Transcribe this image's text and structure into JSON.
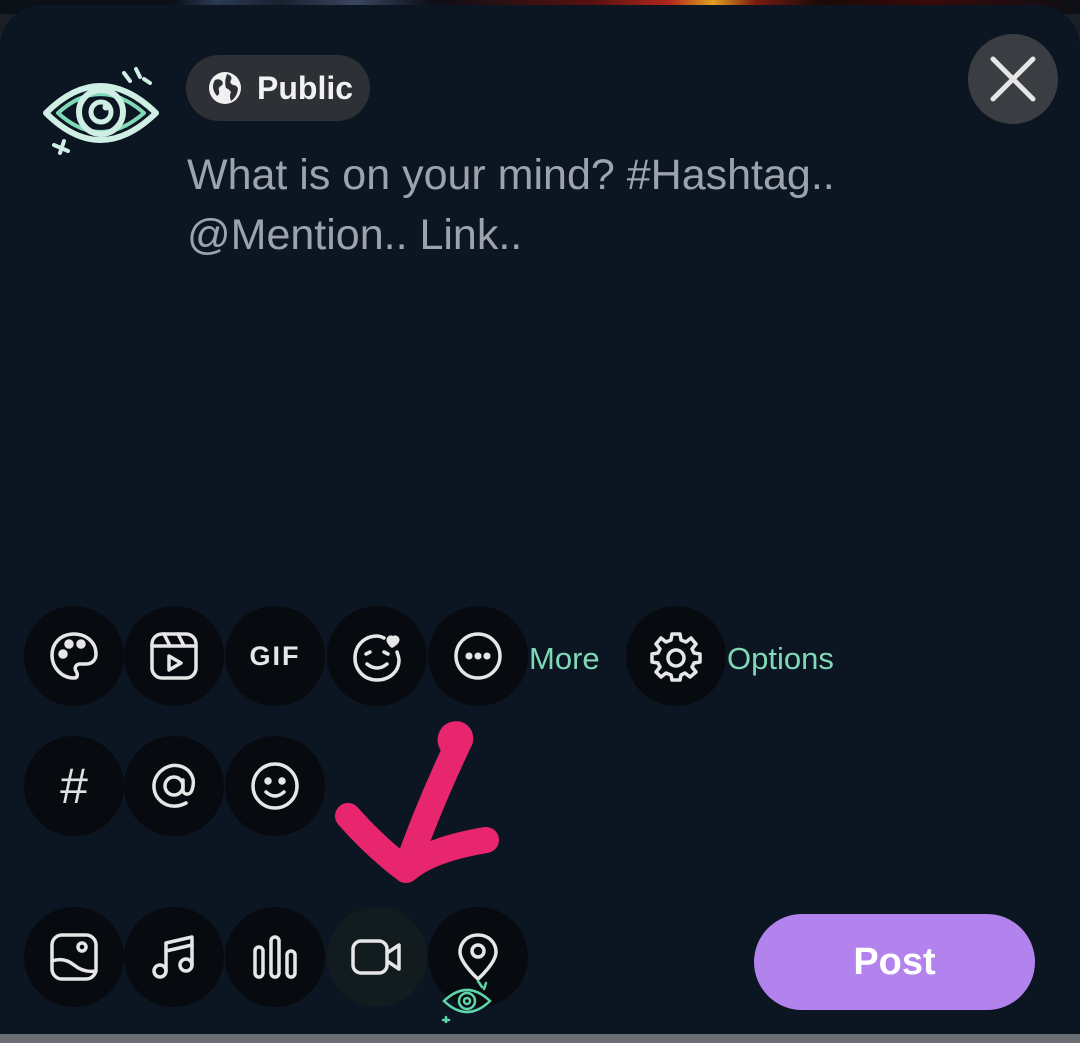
{
  "header": {
    "visibility_label": "Public",
    "visibility_icon": "globe-icon",
    "close_icon": "close-icon"
  },
  "composer": {
    "placeholder": "What is on your mind? #Hashtag.. @Mention.. Link.."
  },
  "toolbar_row1": {
    "items": [
      "palette-icon",
      "reel-icon",
      "gif-icon",
      "emoji-heart-icon",
      "more-dots-icon"
    ],
    "gif_label": "GIF",
    "more_label": "More",
    "options_label": "Options",
    "options_icon": "gear-icon"
  },
  "toolbar_row2": {
    "items": [
      "hashtag-icon",
      "mention-icon",
      "smiley-icon"
    ],
    "hash_label": "#"
  },
  "toolbar_row3": {
    "items": [
      "image-icon",
      "music-icon",
      "poll-icon",
      "video-icon",
      "location-icon"
    ]
  },
  "actions": {
    "post_label": "Post"
  },
  "colors": {
    "background": "#0c1522",
    "accent_text": "#7fd8b6",
    "post_button": "#b283ec",
    "annotation": "#e8266e"
  }
}
